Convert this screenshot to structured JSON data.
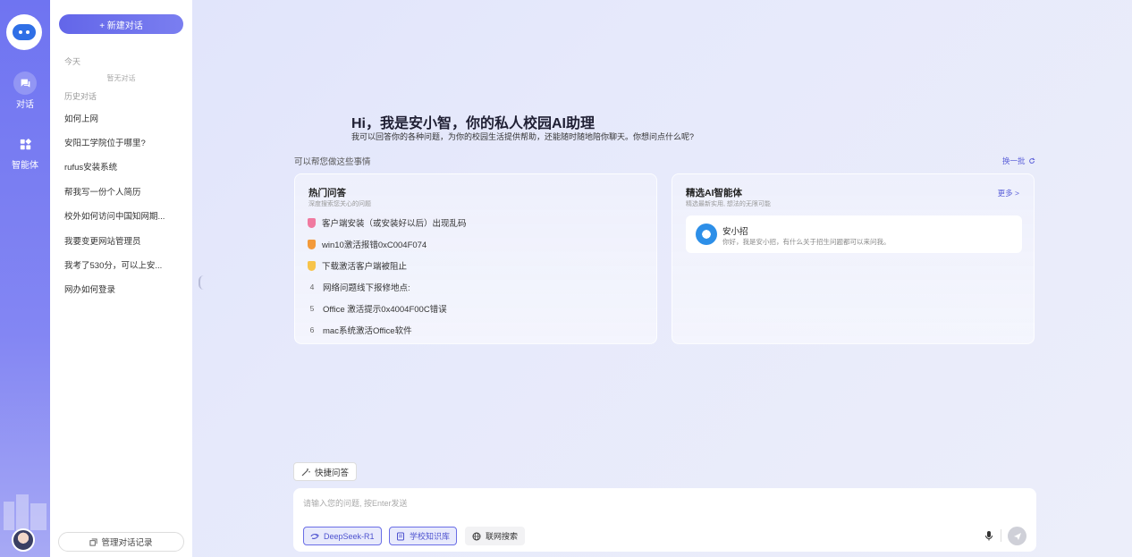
{
  "rail": {
    "items": [
      {
        "label": "对话",
        "icon": "chat-icon",
        "active": true
      },
      {
        "label": "智能体",
        "icon": "apps-icon",
        "active": false
      }
    ]
  },
  "sidebar": {
    "new_chat_label": "+ 新建对话",
    "today_label": "今天",
    "empty_note": "暂无对话",
    "history_label": "历史对话",
    "history": [
      "如何上网",
      "安阳工学院位于哪里?",
      "rufus安装系统",
      "帮我写一份个人简历",
      "校外如何访问中国知网期...",
      "我要变更网站管理员",
      "我考了530分，可以上安...",
      "网办如何登录"
    ],
    "manage_label": "管理对话记录"
  },
  "main": {
    "greeting_title": "Hi，我是安小智，你的私人校园AI助理",
    "greeting_sub": "我可以回答你的各种问题，为你的校园生活提供帮助，还能随时随地陪你聊天。你想问点什么呢?",
    "help_label": "可以帮您做这些事情",
    "refresh_label": "换一批",
    "hot": {
      "title": "热门问答",
      "subtitle": "深度搜索您关心的问题",
      "items": [
        {
          "rank": "1",
          "text": "客户端安装（或安装好以后）出现乱码"
        },
        {
          "rank": "2",
          "text": "win10激活报错0xC004F074"
        },
        {
          "rank": "3",
          "text": "下载激活客户端被阻止"
        },
        {
          "rank": "4",
          "text": "网络问题线下报修地点:"
        },
        {
          "rank": "5",
          "text": "Office 激活提示0x4004F00C错误"
        },
        {
          "rank": "6",
          "text": "mac系统激活Office软件"
        }
      ]
    },
    "agents": {
      "title": "精选AI智能体",
      "subtitle": "精选最新实用, 想法的无限可能",
      "more_label": "更多 >",
      "items": [
        {
          "name": "安小招",
          "desc": "你好，我是安小招，有什么关于招生问题都可以来问我。"
        }
      ]
    }
  },
  "composer": {
    "quick_label": "快捷问答",
    "placeholder": "请输入您的问题, 按Enter发送",
    "chips": [
      {
        "label": "DeepSeek-R1",
        "icon": "deepseek-icon",
        "active": true
      },
      {
        "label": "学校知识库",
        "icon": "book-icon",
        "active": true
      },
      {
        "label": "联网搜索",
        "icon": "globe-icon",
        "active": false
      }
    ]
  },
  "colors": {
    "accent": "#6366e9",
    "rail_top": "#6f74f1",
    "medal_gold": "#f3b431",
    "medal_silver": "#f39a3a",
    "medal_bronze": "#f7c44a",
    "medal_first": "#f07aa0"
  }
}
